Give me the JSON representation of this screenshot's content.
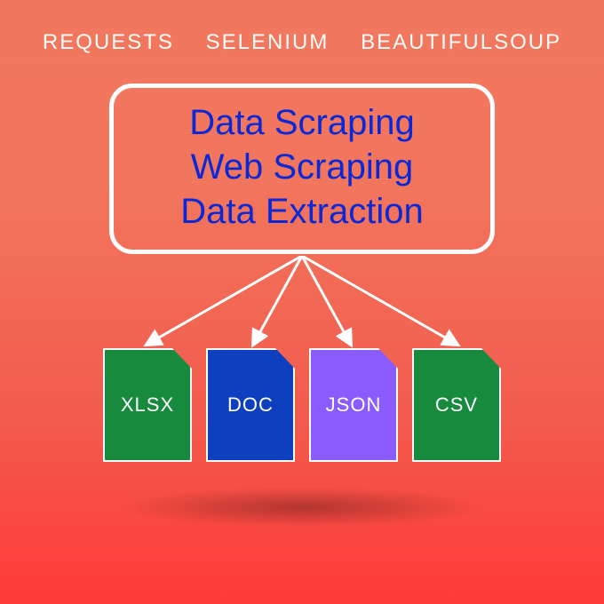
{
  "top_labels": {
    "requests": "REQUESTS",
    "selenium": "SELENIUM",
    "beautifulsoup": "BEAUTIFULSOUP"
  },
  "main_box": {
    "line1": "Data Scraping",
    "line2": "Web Scraping",
    "line3": "Data Extraction"
  },
  "files": {
    "xlsx": {
      "label": "XLSX",
      "color": "green"
    },
    "doc": {
      "label": "DOC",
      "color": "blue"
    },
    "json": {
      "label": "JSON",
      "color": "purple"
    },
    "csv": {
      "label": "CSV",
      "color": "green"
    }
  },
  "colors": {
    "box_border": "#ffffff",
    "box_text": "#0a28d6",
    "bg_top": "#f1785f",
    "bg_bottom": "#ff3a36",
    "file_green": "#178a3e",
    "file_blue": "#0d3fbf",
    "file_purple": "#8a5cff"
  }
}
